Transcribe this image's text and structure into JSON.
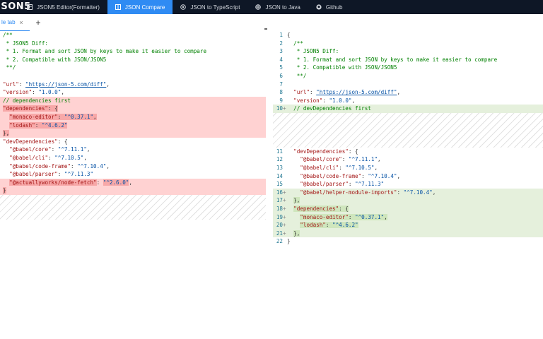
{
  "app": {
    "logo": "JSON5"
  },
  "nav": [
    {
      "label": "JSON5 Editor(Formatter)",
      "icon": "editor-icon",
      "active": false
    },
    {
      "label": "JSON Compare",
      "icon": "compare-icon",
      "active": true
    },
    {
      "label": "JSON to TypeScript",
      "icon": "typescript-icon",
      "active": false
    },
    {
      "label": "JSON to Java",
      "icon": "java-icon",
      "active": false
    },
    {
      "label": "Github",
      "icon": "github-icon",
      "active": false
    }
  ],
  "tabs": {
    "active_label": "le tab",
    "close_glyph": "×",
    "add_glyph": "+"
  },
  "colors": {
    "topbar": "#0e1726",
    "accent": "#2f8bf3",
    "deleted": "#ffd2d2",
    "inserted": "#e5f0dc"
  },
  "diff": {
    "left": [
      {
        "kind": "code",
        "row": 0,
        "tokens": [
          [
            "com",
            "/**"
          ]
        ]
      },
      {
        "kind": "code",
        "row": 1,
        "tokens": [
          [
            "com",
            " * JSON5 Diff:"
          ]
        ]
      },
      {
        "kind": "code",
        "row": 2,
        "tokens": [
          [
            "com",
            " * 1. Format and sort JSON by keys to make it easier to compare"
          ]
        ]
      },
      {
        "kind": "code",
        "row": 3,
        "tokens": [
          [
            "com",
            " * 2. Compatible with JSON/JSON5"
          ]
        ]
      },
      {
        "kind": "code",
        "row": 4,
        "tokens": [
          [
            "com",
            " **/"
          ]
        ]
      },
      {
        "kind": "code",
        "row": 5,
        "tokens": []
      },
      {
        "kind": "code",
        "row": 6,
        "tokens": [
          [
            "key",
            "\"url\""
          ],
          [
            "pun",
            ": "
          ],
          [
            "lnk",
            "\"https://json-5.com/diff\""
          ],
          [
            "pun",
            ","
          ]
        ]
      },
      {
        "kind": "code",
        "row": 7,
        "tokens": [
          [
            "key",
            "\"version\""
          ],
          [
            "pun",
            ": "
          ],
          [
            "str",
            "\"1.0.0\""
          ],
          [
            "pun",
            ","
          ]
        ]
      },
      {
        "kind": "code",
        "row": 8,
        "diff": "del",
        "tokens": [
          [
            "com",
            "// dependencies first"
          ]
        ]
      },
      {
        "kind": "code",
        "row": 9,
        "diff": "del",
        "tokens": [
          [
            "key",
            "\"dependencies\"",
            "hl"
          ],
          [
            "pun",
            ": {",
            "hl"
          ]
        ]
      },
      {
        "kind": "code",
        "row": 10,
        "diff": "del",
        "tokens": [
          [
            "pun",
            "  "
          ],
          [
            "key",
            "\"monaco-editor\"",
            "hl"
          ],
          [
            "pun",
            ": ",
            "hl"
          ],
          [
            "str",
            "\"^0.37.1\"",
            "hl"
          ],
          [
            "pun",
            ",",
            "hl"
          ]
        ]
      },
      {
        "kind": "code",
        "row": 11,
        "diff": "del",
        "tokens": [
          [
            "pun",
            "  "
          ],
          [
            "key",
            "\"lodash\"",
            "hl"
          ],
          [
            "pun",
            ": ",
            "hl"
          ],
          [
            "str",
            "\"^4.6.2\"",
            "hl"
          ]
        ]
      },
      {
        "kind": "code",
        "row": 12,
        "diff": "del",
        "tokens": [
          [
            "pun",
            "},",
            "hl"
          ]
        ]
      },
      {
        "kind": "code",
        "row": 13,
        "tokens": [
          [
            "key",
            "\"devDependencies\""
          ],
          [
            "pun",
            ": {"
          ]
        ]
      },
      {
        "kind": "code",
        "row": 14,
        "tokens": [
          [
            "pun",
            "  "
          ],
          [
            "key",
            "\"@babel/core\""
          ],
          [
            "pun",
            ": "
          ],
          [
            "str",
            "\"^7.11.1\""
          ],
          [
            "pun",
            ","
          ]
        ]
      },
      {
        "kind": "code",
        "row": 15,
        "tokens": [
          [
            "pun",
            "  "
          ],
          [
            "key",
            "\"@babel/cli\""
          ],
          [
            "pun",
            ": "
          ],
          [
            "str",
            "\"^7.10.5\""
          ],
          [
            "pun",
            ","
          ]
        ]
      },
      {
        "kind": "code",
        "row": 16,
        "tokens": [
          [
            "pun",
            "  "
          ],
          [
            "key",
            "\"@babel/code-frame\""
          ],
          [
            "pun",
            ": "
          ],
          [
            "str",
            "\"^7.10.4\""
          ],
          [
            "pun",
            ","
          ]
        ]
      },
      {
        "kind": "code",
        "row": 17,
        "tokens": [
          [
            "pun",
            "  "
          ],
          [
            "key",
            "\"@babel/parser\""
          ],
          [
            "pun",
            ": "
          ],
          [
            "str",
            "\"^7.11.3\""
          ]
        ]
      },
      {
        "kind": "code",
        "row": 18,
        "diff": "del",
        "tokens": [
          [
            "pun",
            "  "
          ],
          [
            "key",
            "\"@actuallyworks/node-fetch\"",
            "hl"
          ],
          [
            "pun",
            ": "
          ],
          [
            "str",
            "\"^2.6.0\"",
            "hl"
          ],
          [
            "pun",
            ","
          ]
        ]
      },
      {
        "kind": "code",
        "row": 19,
        "diff": "del",
        "tokens": [
          [
            "pun",
            "}",
            "hl"
          ]
        ]
      },
      {
        "kind": "hatch",
        "row": 20,
        "rows": 3
      }
    ],
    "right": [
      {
        "kind": "code",
        "row": 0,
        "ln": "1",
        "tokens": [
          [
            "pun",
            "{"
          ]
        ]
      },
      {
        "kind": "code",
        "row": 1,
        "ln": "2",
        "tokens": [
          [
            "com",
            "  /**"
          ]
        ]
      },
      {
        "kind": "code",
        "row": 2,
        "ln": "3",
        "tokens": [
          [
            "com",
            "   * JSON5 Diff:"
          ]
        ]
      },
      {
        "kind": "code",
        "row": 3,
        "ln": "4",
        "tokens": [
          [
            "com",
            "   * 1. Format and sort JSON by keys to make it easier to compare"
          ]
        ]
      },
      {
        "kind": "code",
        "row": 4,
        "ln": "5",
        "tokens": [
          [
            "com",
            "   * 2. Compatible with JSON/JSON5"
          ]
        ]
      },
      {
        "kind": "code",
        "row": 5,
        "ln": "6",
        "tokens": [
          [
            "com",
            "   **/"
          ]
        ]
      },
      {
        "kind": "code",
        "row": 6,
        "ln": "7",
        "tokens": []
      },
      {
        "kind": "code",
        "row": 7,
        "ln": "8",
        "tokens": [
          [
            "pun",
            "  "
          ],
          [
            "key",
            "\"url\""
          ],
          [
            "pun",
            ": "
          ],
          [
            "lnk",
            "\"https://json-5.com/diff\""
          ],
          [
            "pun",
            ","
          ]
        ]
      },
      {
        "kind": "code",
        "row": 8,
        "ln": "9",
        "tokens": [
          [
            "pun",
            "  "
          ],
          [
            "key",
            "\"version\""
          ],
          [
            "pun",
            ": "
          ],
          [
            "str",
            "\"1.0.0\""
          ],
          [
            "pun",
            ","
          ]
        ]
      },
      {
        "kind": "code",
        "row": 9,
        "ln": "10",
        "mark": "+",
        "diff": "ins",
        "tokens": [
          [
            "pun",
            "  "
          ],
          [
            "com",
            "// devDependencies first"
          ]
        ]
      },
      {
        "kind": "hatch",
        "row": 10,
        "rows": 4.2
      },
      {
        "kind": "code",
        "row": 14.2,
        "ln": "11",
        "tokens": [
          [
            "pun",
            "  "
          ],
          [
            "key",
            "\"devDependencies\""
          ],
          [
            "pun",
            ": {"
          ]
        ]
      },
      {
        "kind": "code",
        "row": 15.2,
        "ln": "12",
        "tokens": [
          [
            "pun",
            "    "
          ],
          [
            "key",
            "\"@babel/core\""
          ],
          [
            "pun",
            ": "
          ],
          [
            "str",
            "\"^7.11.1\""
          ],
          [
            "pun",
            ","
          ]
        ]
      },
      {
        "kind": "code",
        "row": 16.2,
        "ln": "13",
        "tokens": [
          [
            "pun",
            "    "
          ],
          [
            "key",
            "\"@babel/cli\""
          ],
          [
            "pun",
            ": "
          ],
          [
            "str",
            "\"^7.10.5\""
          ],
          [
            "pun",
            ","
          ]
        ]
      },
      {
        "kind": "code",
        "row": 17.2,
        "ln": "14",
        "tokens": [
          [
            "pun",
            "    "
          ],
          [
            "key",
            "\"@babel/code-frame\""
          ],
          [
            "pun",
            ": "
          ],
          [
            "str",
            "\"^7.10.4\""
          ],
          [
            "pun",
            ","
          ]
        ]
      },
      {
        "kind": "code",
        "row": 18.2,
        "ln": "15",
        "tokens": [
          [
            "pun",
            "    "
          ],
          [
            "key",
            "\"@babel/parser\""
          ],
          [
            "pun",
            ": "
          ],
          [
            "str",
            "\"^7.11.3\""
          ]
        ]
      },
      {
        "kind": "code",
        "row": 19.2,
        "ln": "16",
        "mark": "+",
        "diff": "ins",
        "tokens": [
          [
            "pun",
            "    "
          ],
          [
            "key",
            "\"@babel/helper-module-imports\""
          ],
          [
            "pun",
            ": "
          ],
          [
            "str",
            "\"^7.10.4\""
          ],
          [
            "pun",
            ","
          ]
        ]
      },
      {
        "kind": "code",
        "row": 20.2,
        "ln": "17",
        "mark": "+",
        "diff": "ins",
        "tokens": [
          [
            "pun",
            "  "
          ],
          [
            "pun",
            "},",
            "hl"
          ]
        ]
      },
      {
        "kind": "code",
        "row": 21.2,
        "ln": "18",
        "mark": "+",
        "diff": "ins",
        "tokens": [
          [
            "pun",
            "  "
          ],
          [
            "key",
            "\"dependencies\"",
            "hl"
          ],
          [
            "pun",
            ": {",
            "hl"
          ]
        ]
      },
      {
        "kind": "code",
        "row": 22.2,
        "ln": "19",
        "mark": "+",
        "diff": "ins",
        "tokens": [
          [
            "pun",
            "    "
          ],
          [
            "key",
            "\"monaco-editor\"",
            "hl"
          ],
          [
            "pun",
            ": ",
            "hl"
          ],
          [
            "str",
            "\"^0.37.1\"",
            "hl"
          ],
          [
            "pun",
            ",",
            "hl"
          ]
        ]
      },
      {
        "kind": "code",
        "row": 23.2,
        "ln": "20",
        "mark": "+",
        "diff": "ins",
        "tokens": [
          [
            "pun",
            "    "
          ],
          [
            "key",
            "\"lodash\"",
            "hl"
          ],
          [
            "pun",
            ": ",
            "hl"
          ],
          [
            "str",
            "\"^4.6.2\"",
            "hl"
          ]
        ]
      },
      {
        "kind": "code",
        "row": 24.2,
        "ln": "21",
        "mark": "+",
        "diff": "ins",
        "tokens": [
          [
            "pun",
            "  "
          ],
          [
            "pun",
            "},",
            "hl"
          ]
        ]
      },
      {
        "kind": "code",
        "row": 25.2,
        "ln": "22",
        "tokens": [
          [
            "pun",
            "}"
          ]
        ]
      }
    ]
  }
}
